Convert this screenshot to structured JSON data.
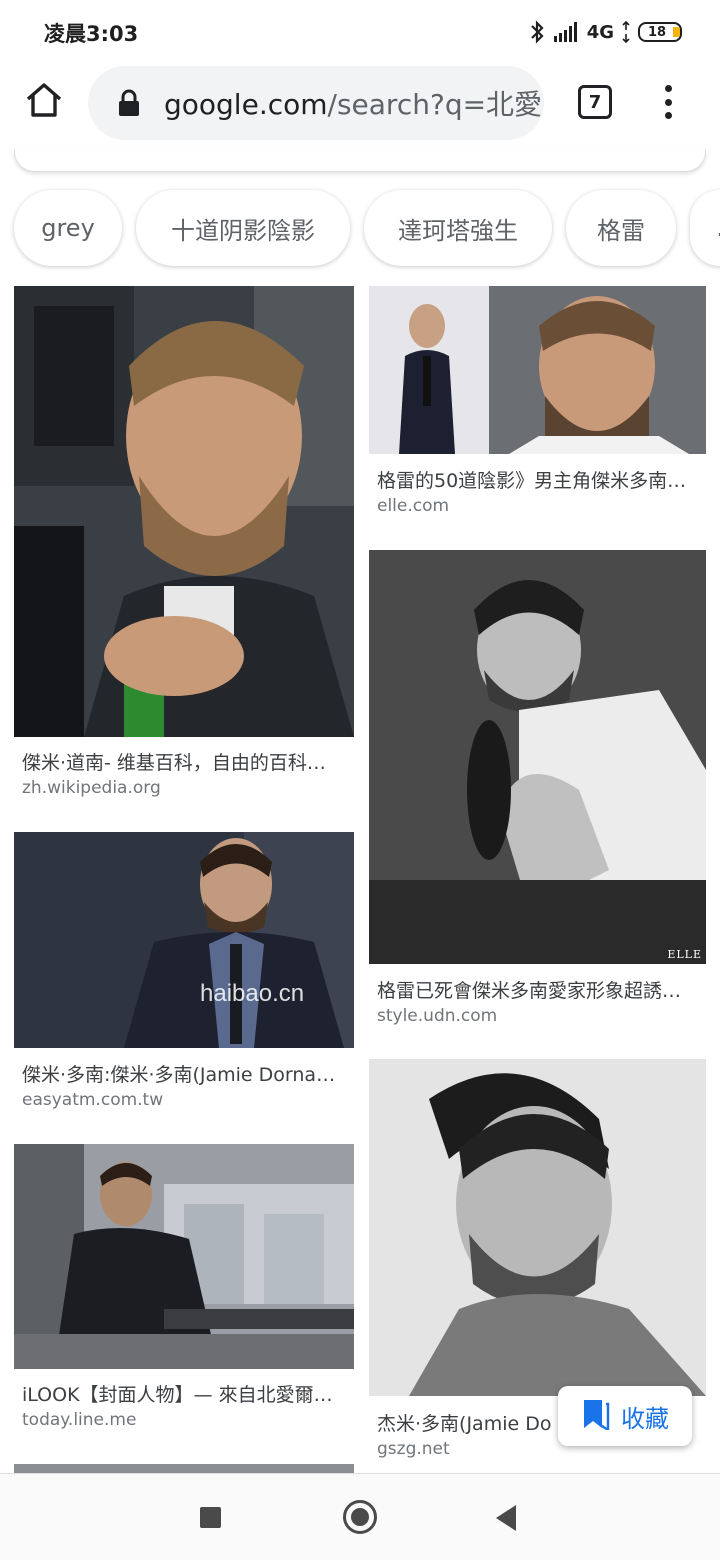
{
  "status_bar": {
    "time": "凌晨3:03",
    "network": "4G",
    "battery": "18",
    "icons": [
      "bluetooth-icon",
      "signal-icon",
      "battery-icon"
    ]
  },
  "browser": {
    "url_host": "google.com",
    "url_path": "/search?q=北愛",
    "tab_count": "7",
    "icons": [
      "home-icon",
      "lock-icon",
      "tabs-icon",
      "overflow-menu-icon"
    ]
  },
  "chips": [
    {
      "label": "grey"
    },
    {
      "label": "十道阴影陰影"
    },
    {
      "label": "達珂塔強生"
    },
    {
      "label": "格雷"
    },
    {
      "label": "."
    }
  ],
  "results": [
    {
      "title": "傑米·道南- 维基百科，自由的百科…",
      "source": "zh.wikipedia.org"
    },
    {
      "title": "格雷的50道陰影》男主角傑米多南…",
      "source": "elle.com"
    },
    {
      "title": "傑米·多南:傑米·多南(Jamie Dorna…",
      "source": "easyatm.com.tw"
    },
    {
      "title": "格雷已死會傑米多南愛家形象超誘…",
      "source": "style.udn.com"
    },
    {
      "title": "iLOOK【封面人物】— 來自北愛爾…",
      "source": "today.line.me"
    },
    {
      "title": "杰米·多南(Jamie Do",
      "source": "gszg.net"
    }
  ],
  "image_text": {
    "watermark_haiba": "haibao.cn",
    "watermark_elle": "ELLE"
  },
  "save_button": {
    "label": "收藏",
    "icon": "bookmark-icon"
  },
  "colors": {
    "accent": "#1a73e8",
    "chip_text": "#5f6368",
    "source_text": "#70757a"
  },
  "nav_bar": {
    "icons": [
      "recents-icon",
      "home-circle-icon",
      "back-icon"
    ]
  }
}
